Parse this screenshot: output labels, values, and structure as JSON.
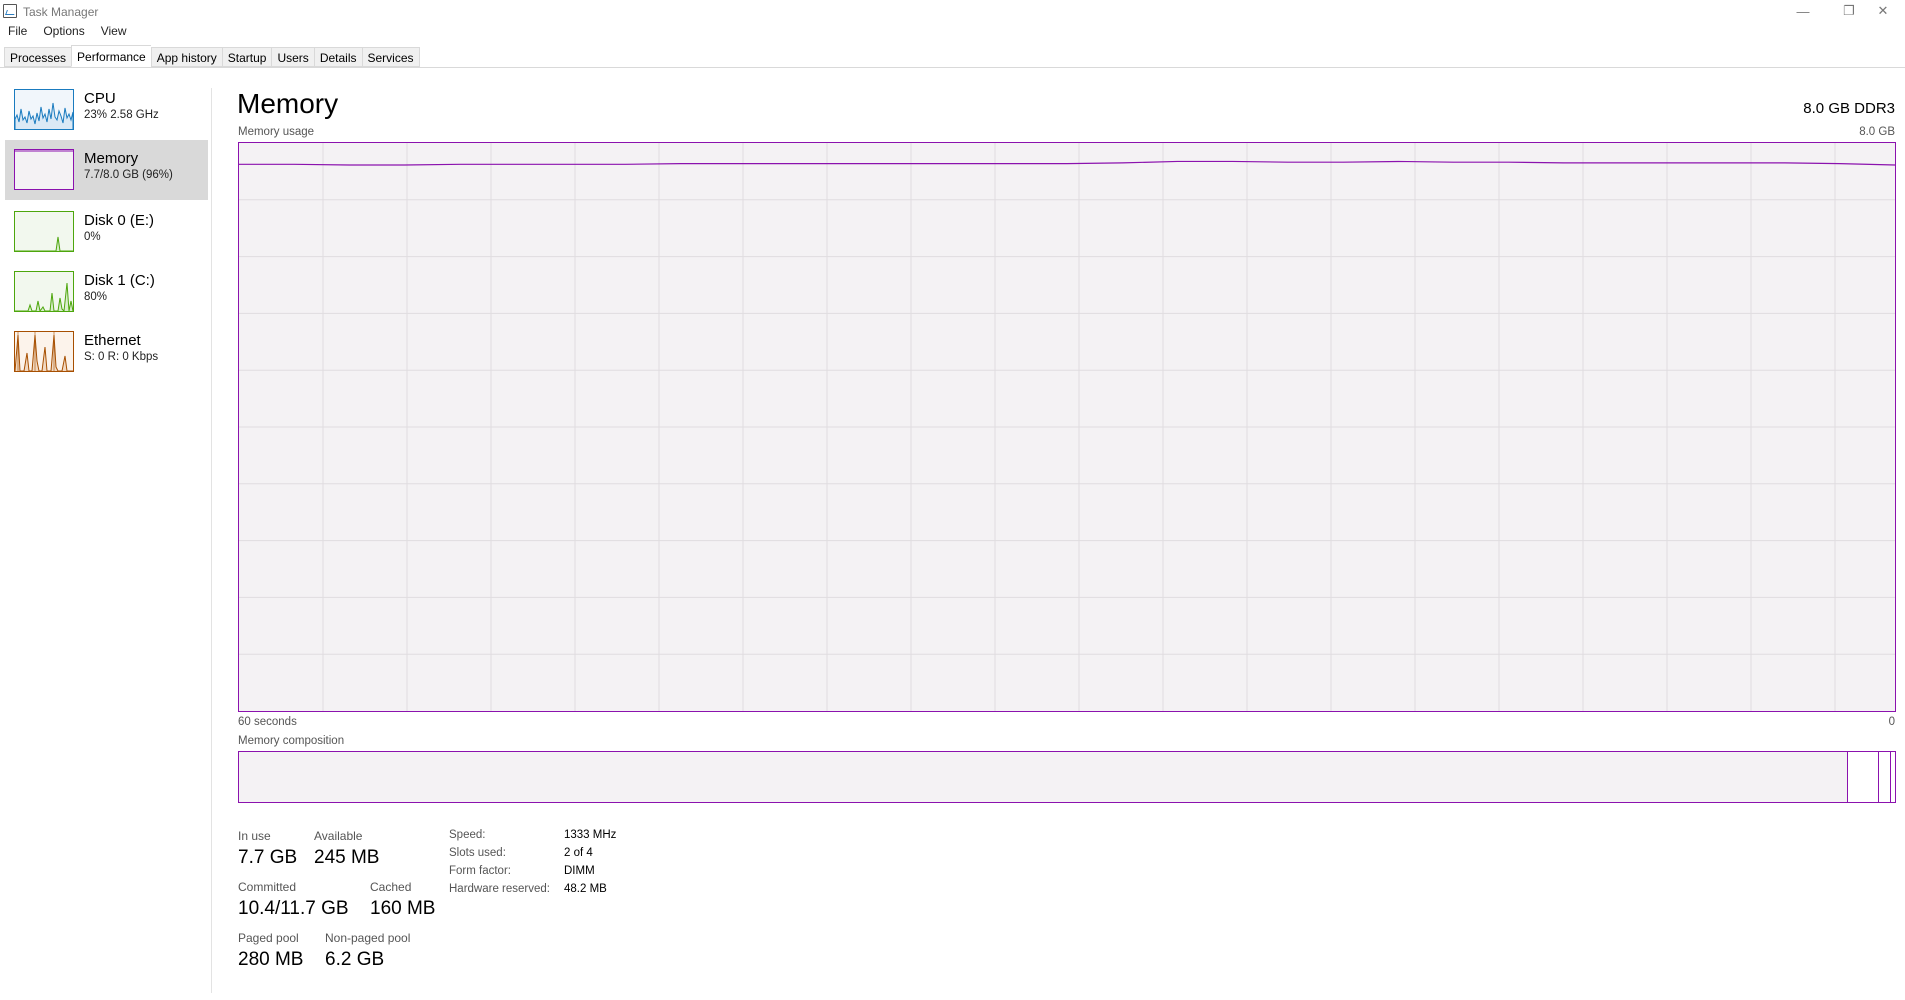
{
  "window": {
    "title": "Task Manager",
    "minimize": "—",
    "maximize": "❐",
    "close": "✕"
  },
  "menu": [
    "File",
    "Options",
    "View"
  ],
  "tabs": [
    {
      "label": "Processes",
      "active": false
    },
    {
      "label": "Performance",
      "active": true
    },
    {
      "label": "App history",
      "active": false
    },
    {
      "label": "Startup",
      "active": false
    },
    {
      "label": "Users",
      "active": false
    },
    {
      "label": "Details",
      "active": false
    },
    {
      "label": "Services",
      "active": false
    }
  ],
  "sidebar": {
    "items": [
      {
        "label": "CPU",
        "sub": "23%  2.58 GHz",
        "color": "#1a7bbf",
        "fill": "#f1f6fb"
      },
      {
        "label": "Memory",
        "sub": "7.7/8.0 GB (96%)",
        "color": "#8b12ae",
        "fill": "#f4f2f4"
      },
      {
        "label": "Disk 0 (E:)",
        "sub": "0%",
        "color": "#4da60c",
        "fill": "#f2f8ee"
      },
      {
        "label": "Disk 1 (C:)",
        "sub": "80%",
        "color": "#4da60c",
        "fill": "#f2f8ee"
      },
      {
        "label": "Ethernet",
        "sub": "S: 0 R: 0 Kbps",
        "color": "#a74f01",
        "fill": "#fcf3eb"
      }
    ]
  },
  "main": {
    "title": "Memory",
    "spec": "8.0 GB DDR3",
    "usage_label": "Memory usage",
    "usage_max": "8.0 GB",
    "time_left": "60 seconds",
    "time_right": "0",
    "composition_label": "Memory composition",
    "accent": "#8b12ae"
  },
  "memory_graph": {
    "max_gb": 8.0,
    "series_gb": [
      7.7,
      7.7,
      7.69,
      7.69,
      7.7,
      7.7,
      7.7,
      7.7,
      7.71,
      7.71,
      7.71,
      7.71,
      7.71,
      7.71,
      7.71,
      7.71,
      7.72,
      7.74,
      7.74,
      7.73,
      7.73,
      7.74,
      7.73,
      7.73,
      7.72,
      7.72,
      7.72,
      7.72,
      7.72,
      7.71,
      7.69
    ]
  },
  "composition": {
    "in_use_fraction": 0.971,
    "modified_fraction": 0.019,
    "standby_fraction": 0.007
  },
  "stats": {
    "in_use_label": "In use",
    "in_use": "7.7 GB",
    "available_label": "Available",
    "available": "245 MB",
    "committed_label": "Committed",
    "committed": "10.4/11.7 GB",
    "cached_label": "Cached",
    "cached": "160 MB",
    "paged_label": "Paged pool",
    "paged": "280 MB",
    "nonpaged_label": "Non-paged pool",
    "nonpaged": "6.2 GB"
  },
  "specs": {
    "speed_label": "Speed:",
    "speed": "1333 MHz",
    "slots_label": "Slots used:",
    "slots": "2 of 4",
    "form_label": "Form factor:",
    "form": "DIMM",
    "reserved_label": "Hardware reserved:",
    "reserved": "48.2 MB"
  }
}
